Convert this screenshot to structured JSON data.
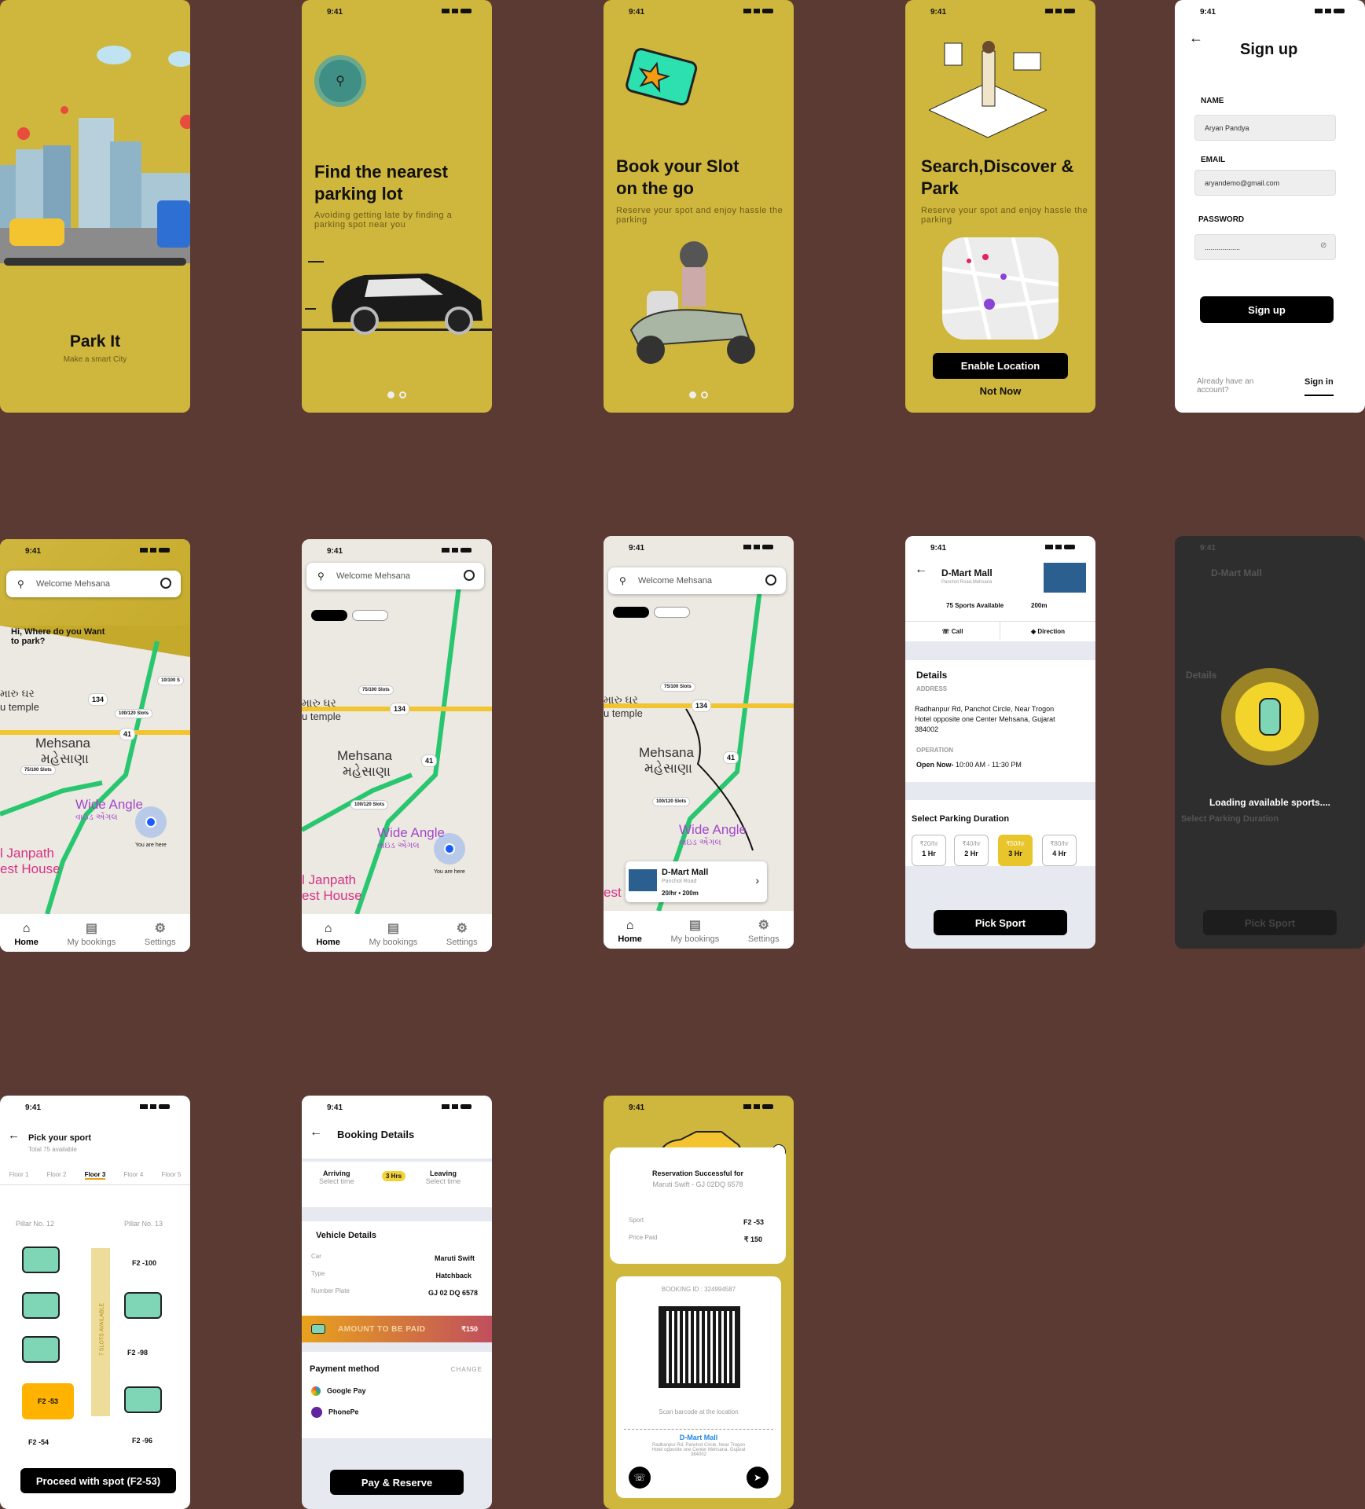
{
  "colors": {
    "background": "#5b3a33",
    "yellow": "#cfb63d",
    "accent": "#ffb200",
    "green": "#28c76f"
  },
  "status_time": "9:41",
  "splash": {
    "title": "Park It",
    "subtitle": "Make a smart City"
  },
  "onboard1": {
    "title": "Find the nearest parking lot",
    "subtitle": "Avoiding getting late by finding a parking spot near you",
    "icon": "search-icon"
  },
  "onboard2": {
    "title": "Book your Slot on the go",
    "subtitle": "Reserve your spot and enjoy hassle the parking"
  },
  "onboard3": {
    "title": "Search,Discover & Park",
    "subtitle": "Reserve your spot and enjoy hassle the parking",
    "enable": "Enable Location",
    "not_now": "Not Now"
  },
  "signup": {
    "title": "Sign up",
    "name_label": "NAME",
    "name_value": "Aryan Pandya",
    "email_label": "EMAIL",
    "email_value": "aryandemo@gmail.com",
    "password_label": "PASSWORD",
    "password_value": "..................",
    "button": "Sign up",
    "already": "Already have an account?",
    "signin": "Sign in"
  },
  "map": {
    "search_placeholder": "Welcome Mehsana",
    "greeting": "Hi, Where do you Want to park?",
    "city": "Mehsana",
    "city_gu": "મહેસાણા",
    "place1": "Wide Angle",
    "place1_gu": "વાઇડ એંગલ",
    "place2": "l Janpath",
    "place3": "est House",
    "temple": "u temple",
    "temple_gu": "મારુ ઘર",
    "road1": "134",
    "road2": "41",
    "slots1": "75/100 Slots",
    "slots2": "100/120 Slots",
    "slots3": "10/100 S",
    "you_are_here": "You are here"
  },
  "nav": {
    "home": "Home",
    "bookings": "My bookings",
    "settings": "Settings"
  },
  "result_card": {
    "name": "D-Mart Mall",
    "address": "Panchot Road",
    "meta": "20/hr • 200m"
  },
  "mall": {
    "name": "D-Mart Mall",
    "road": "Panchot Road,Mehsana",
    "spots": "75 Sports Available",
    "distance": "200m",
    "call": "Call",
    "direction": "Direction",
    "details": "Details",
    "address_label": "ADDRESS",
    "address": "Radhanpur Rd, Panchot Circle, Near Trogon Hotel opposite one Center Mehsana, Gujarat 384002",
    "operation_label": "OPERATION",
    "open": "Open Now-",
    "hours": "10:00 AM - 11:30 PM",
    "duration_title": "Select Parking Duration",
    "durations": [
      {
        "price": "₹20/hr",
        "hrs": "1 Hr"
      },
      {
        "price": "₹40/hr",
        "hrs": "2 Hr"
      },
      {
        "price": "₹50/hr",
        "hrs": "3 Hr"
      },
      {
        "price": "₹80/hr",
        "hrs": "4 Hr"
      }
    ],
    "button": "Pick Sport",
    "loading": "Loading available sports...."
  },
  "pick": {
    "title": "Pick your sport",
    "sub": "Total 75 available",
    "floors": [
      "Floor 1",
      "Floor 2",
      "Floor 3",
      "Floor 4",
      "Floor 5"
    ],
    "pillar1": "Pillar No. 12",
    "pillar2": "Pillar No. 13",
    "avail": "7 SLOTS AVAILABLE",
    "s1": "F2 -100",
    "s2": "F2 -98",
    "s3": "F2 -53",
    "s4": "F2 -54",
    "s5": "F2 -96",
    "button": "Proceed with spot (F2-53)"
  },
  "booking": {
    "title": "Booking Details",
    "arriving": "Arriving",
    "leaving": "Leaving",
    "select": "Select time",
    "hrs": "3 Hrs",
    "vehicle": "Vehicle Details",
    "car_l": "Car",
    "car": "Maruti Swift",
    "type_l": "Type",
    "type": "Hatchback",
    "plate_l": "Number Plate",
    "plate": "GJ 02 DQ 6578",
    "amount": "AMOUNT TO BE PAID",
    "amount_v": "₹150",
    "payment": "Payment method",
    "change": "CHANGE",
    "gpay": "Google Pay",
    "phonepe": "PhonePe",
    "button": "Pay & Reserve"
  },
  "success": {
    "title": "Reservation Successful for",
    "car": "Maruti Swift - GJ 02DQ 6578",
    "sport_l": "Sport",
    "sport": "F2 -53",
    "price_l": "Price Paid",
    "price": "₹ 150",
    "booking_id": "BOOKING ID : 324994587",
    "scan": "Scan barcode at the location",
    "mall": "D-Mart Mall",
    "address": "Radhanpur Rd, Panchot Circle, Near Trogon Hotel opposite one Center Mehsana, Gujarat 384002"
  }
}
